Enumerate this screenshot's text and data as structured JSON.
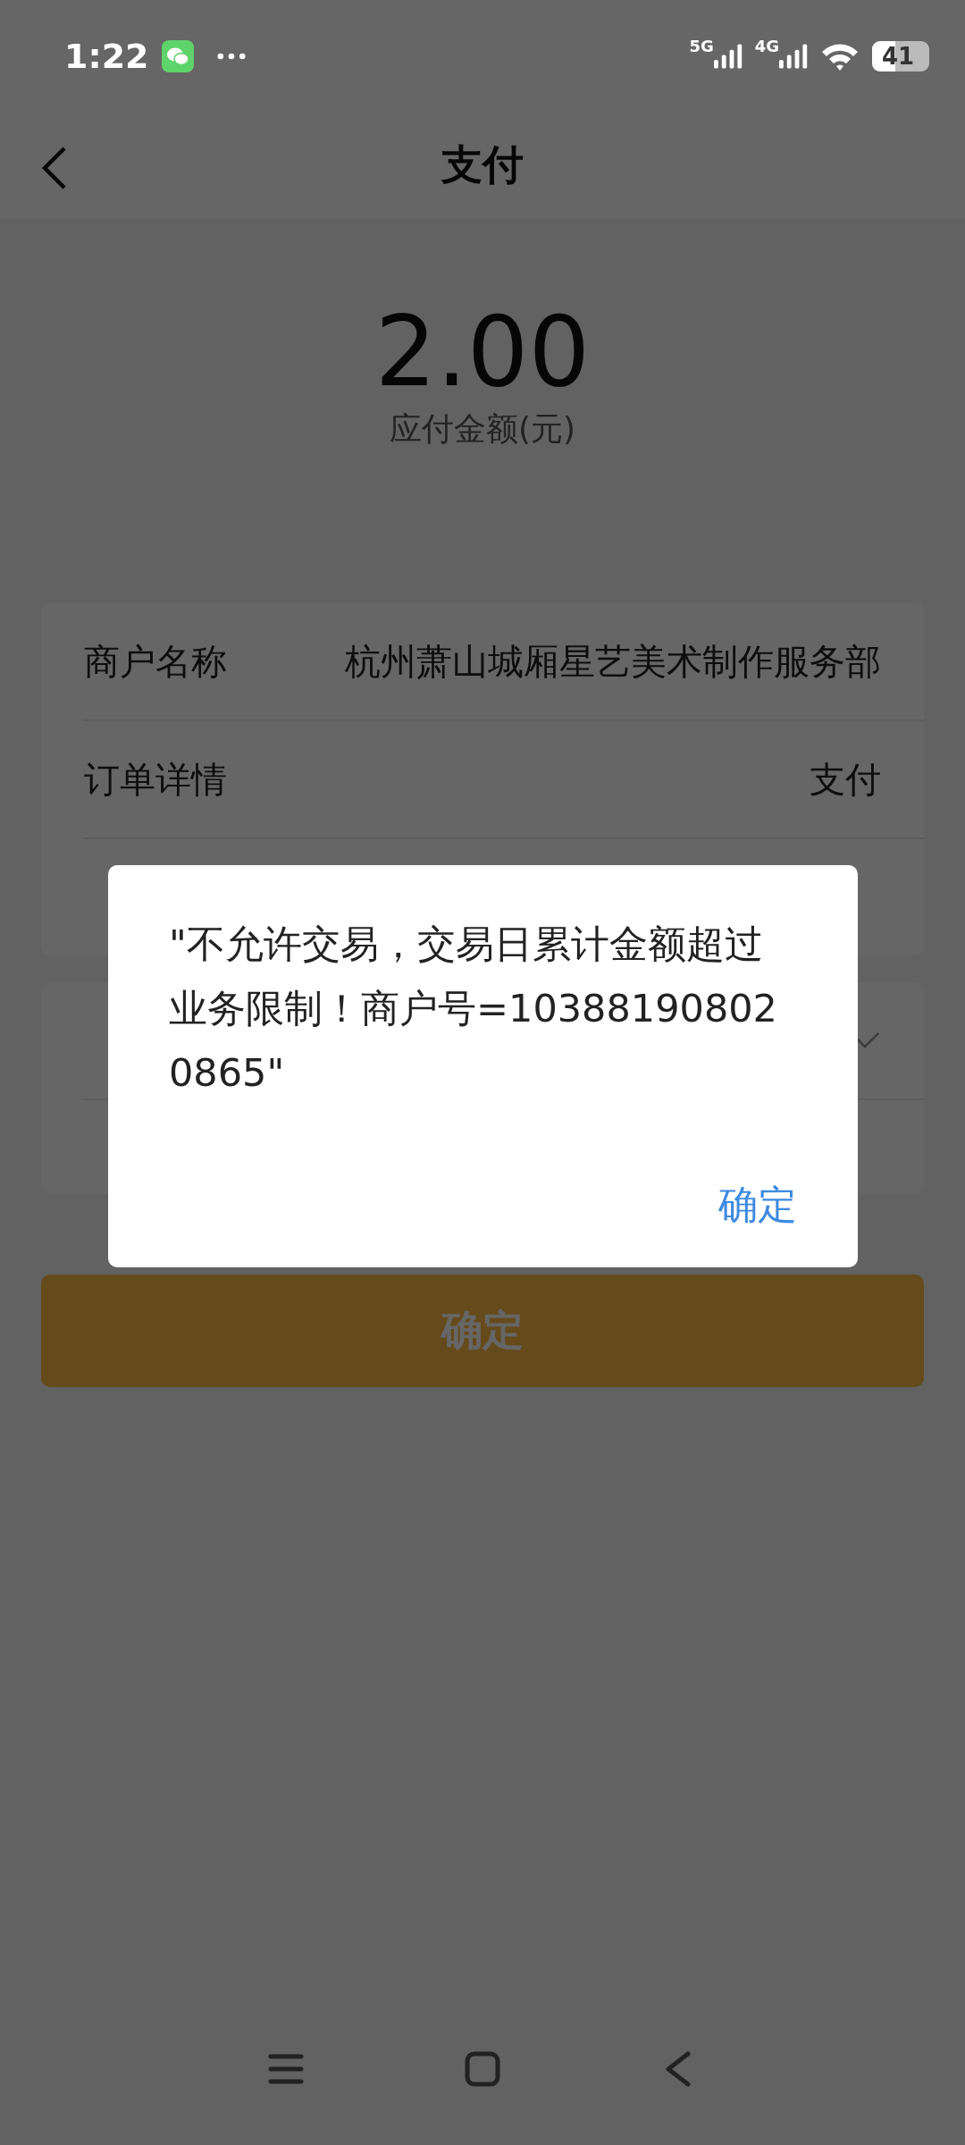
{
  "status_bar": {
    "time": "1:22",
    "networks": [
      "5G",
      "4G"
    ],
    "battery": "41"
  },
  "header": {
    "title": "支付"
  },
  "amount": {
    "value": "2.00",
    "label": "应付金额(元)"
  },
  "order_card": [
    {
      "label": "商户名称",
      "value": "杭州萧山城厢星艺美术制作服务部"
    },
    {
      "label": "订单详情",
      "value": "支付"
    }
  ],
  "payment_card": [
    {
      "kind": "select"
    }
  ],
  "confirm_button": "确定",
  "dialog": {
    "message": "\"不允许交易，交易日累计金额超过业务限制！商户号=103881908020865\"",
    "button": "确定"
  }
}
